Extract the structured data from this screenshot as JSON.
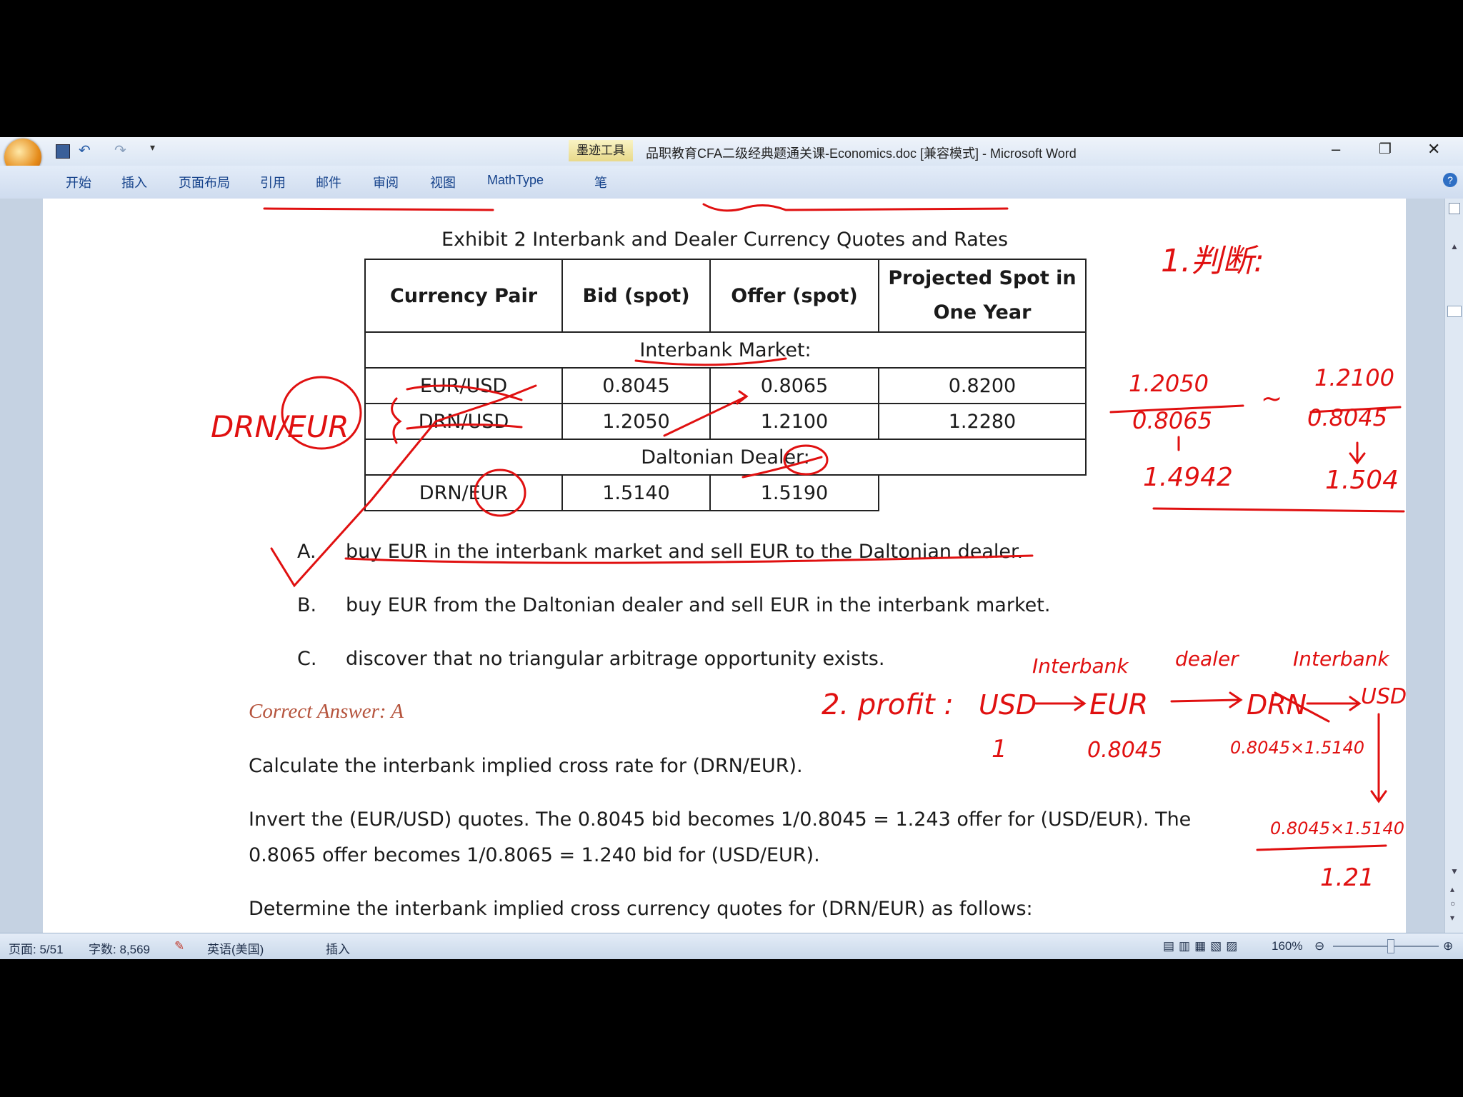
{
  "window": {
    "title": "品职教育CFA二级经典题通关课-Economics.doc [兼容模式] - Microsoft Word",
    "ink_tools_label": "墨迹工具",
    "pen_tab": "笔",
    "minimize": "–",
    "restore": "❐",
    "close": "✕"
  },
  "ribbon": {
    "tabs": [
      "开始",
      "插入",
      "页面布局",
      "引用",
      "邮件",
      "审阅",
      "视图",
      "MathType"
    ]
  },
  "document": {
    "exhibit_title": "Exhibit 2 Interbank and Dealer Currency Quotes and Rates",
    "table": {
      "headers": [
        "Currency Pair",
        "Bid (spot)",
        "Offer (spot)",
        "Projected Spot in One Year"
      ],
      "section1": "Interbank Market:",
      "rows1": [
        [
          "EUR/USD",
          "0.8045",
          "0.8065",
          "0.8200"
        ],
        [
          "DRN/USD",
          "1.2050",
          "1.2100",
          "1.2280"
        ]
      ],
      "section2": "Daltonian Dealer:",
      "rows2": [
        [
          "DRN/EUR",
          "1.5140",
          "1.5190"
        ]
      ]
    },
    "options": [
      {
        "letter": "A.",
        "text": "buy EUR in the interbank market and sell EUR to the Daltonian dealer."
      },
      {
        "letter": "B.",
        "text": "buy EUR from the Daltonian dealer and sell EUR in the interbank market."
      },
      {
        "letter": "C.",
        "text": "discover that no triangular arbitrage opportunity exists."
      }
    ],
    "correct_answer": "Correct Answer: A",
    "para1": "Calculate the interbank implied cross rate for (DRN/EUR).",
    "para2_line1": "Invert the (EUR/USD) quotes. The 0.8045 bid becomes 1/0.8045 = 1.243 offer for (USD/EUR). The",
    "para2_line2": "0.8065 offer becomes 1/0.8065 = 1.240 bid for (USD/EUR).",
    "para3": "Determine the interbank implied cross currency quotes for (DRN/EUR) as follows:"
  },
  "annotations": {
    "drn_eur": "DRN/EUR",
    "step1": "1.判断:",
    "frac1_num": "1.2050",
    "frac1_den": "0.8065",
    "frac1_res": "1.4942",
    "frac2_num": "1.2100",
    "frac2_den": "0.8045",
    "frac2_res": "1.504",
    "tilde": "~",
    "step2": "2. profit :",
    "chain": [
      "USD",
      "EUR",
      "DRN",
      "USD"
    ],
    "chain_labels": [
      "Interbank",
      "dealer",
      "Interbank"
    ],
    "start_amt": "1",
    "amt_eur": "0.8045",
    "amt_drn": "0.8045×1.5140",
    "calc_num": "0.8045×1.5140",
    "calc_den": "1.21",
    "ink_color": "#e01010"
  },
  "status": {
    "page": "页面: 5/51",
    "words": "字数: 8,569",
    "language": "英语(美国)",
    "mode": "插入",
    "zoom": "160%"
  }
}
